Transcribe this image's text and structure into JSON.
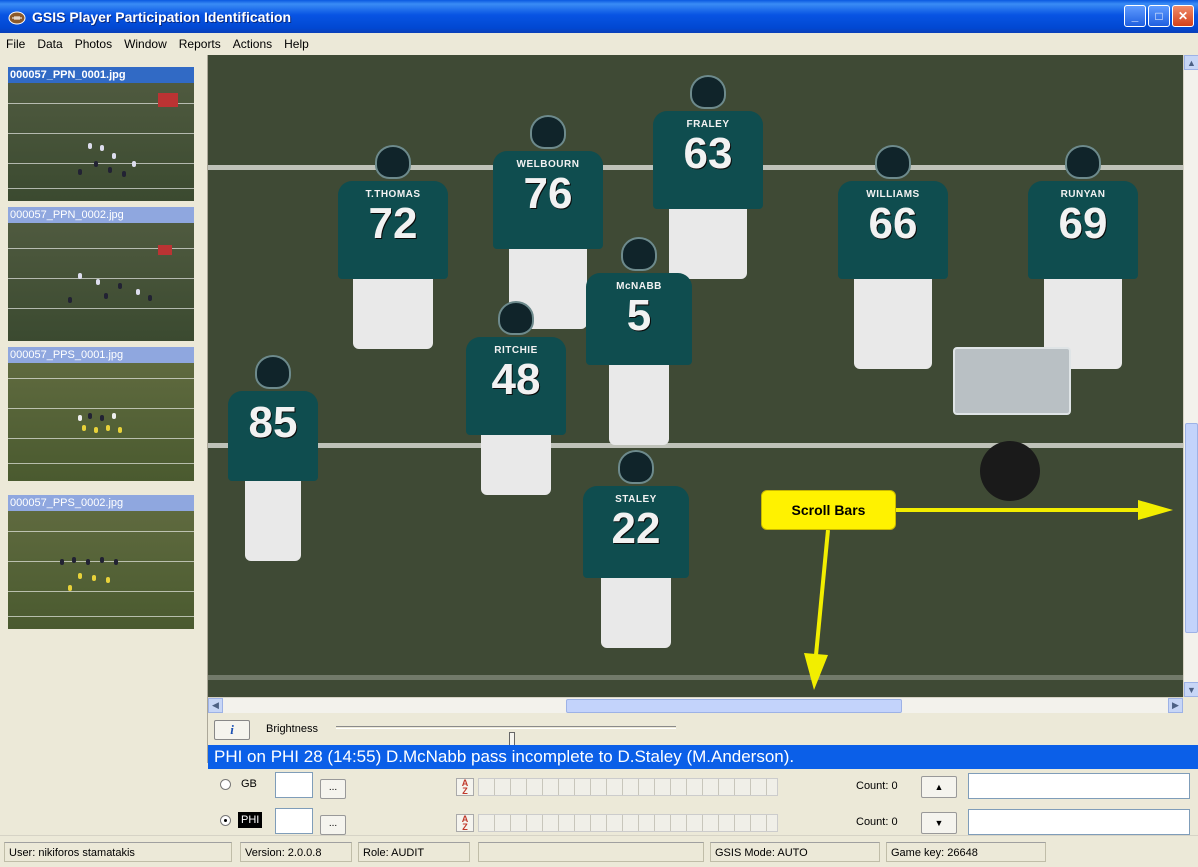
{
  "window": {
    "title": "GSIS Player Participation Identification",
    "buttons": [
      "_",
      "□",
      "✕"
    ]
  },
  "menu": [
    "File",
    "Data",
    "Photos",
    "Window",
    "Reports",
    "Actions",
    "Help"
  ],
  "thumbnails": [
    {
      "label": "000057_PPN_0001.jpg",
      "selected": true
    },
    {
      "label": "000057_PPN_0002.jpg",
      "selected": false
    },
    {
      "label": "000057_PPS_0001.jpg",
      "selected": false
    },
    {
      "label": "000057_PPS_0002.jpg",
      "selected": false
    }
  ],
  "photo": {
    "players": [
      {
        "name": "T.THOMAS",
        "number": "72"
      },
      {
        "name": "WELBOURN",
        "number": "76"
      },
      {
        "name": "FRALEY",
        "number": "63"
      },
      {
        "name": "WILLIAMS",
        "number": "66"
      },
      {
        "name": "RUNYAN",
        "number": "69"
      },
      {
        "name": "McNABB",
        "number": "5"
      },
      {
        "name": "RITCHIE",
        "number": "48"
      },
      {
        "name": "",
        "number": "85"
      },
      {
        "name": "STALEY",
        "number": "22"
      }
    ],
    "callout": "Scroll Bars"
  },
  "controls": {
    "info_icon": "info-icon",
    "brightness_label": "Brightness",
    "brightness_level": 0.51
  },
  "play": "PHI on PHI 28  (14:55) D.McNabb pass incomplete to D.Staley (M.Anderson).",
  "teams": [
    {
      "abbr": "GB",
      "selected": false,
      "ellipsis": "...",
      "count": "Count: 0",
      "arrow": "▲"
    },
    {
      "abbr": "PHI",
      "selected": true,
      "ellipsis": "...",
      "count": "Count: 0",
      "arrow": "▼"
    }
  ],
  "status": {
    "user": "User: nikiforos stamatakis",
    "version": "Version: 2.0.0.8",
    "role": "Role: AUDIT",
    "blank": "",
    "mode": "GSIS Mode: AUTO",
    "game_key": "Game key: 26648"
  },
  "colors": {
    "titlebar": "#0148d2",
    "playbar": "#0b5fe8",
    "callout": "#fff200",
    "arrow": "#f2ee00",
    "jersey": "#0f4d4f"
  }
}
